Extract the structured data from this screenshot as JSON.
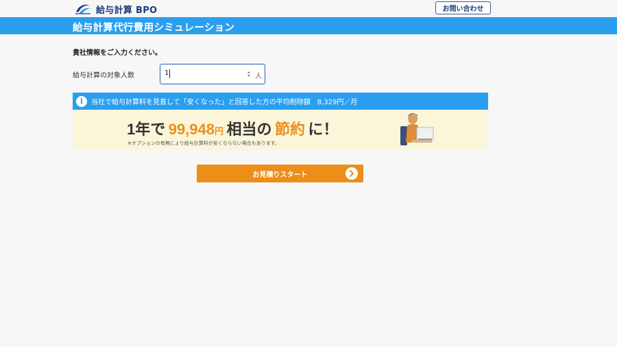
{
  "header": {
    "logo_text": "給与計算 BPO",
    "contact_label": "お問い合わせ"
  },
  "title_bar": {
    "title": "給与計算代行費用シミュレーション"
  },
  "form": {
    "prompt": "貴社情報をご入力ください。",
    "field_label": "給与計算の対象人数",
    "field_value": "1",
    "unit": "人"
  },
  "info": {
    "icon": "info-icon",
    "text": "当社で給与計算料を見直して「安くなった」と回答した方の平均削除額　8,329円／月"
  },
  "saving": {
    "prefix": "1年で",
    "amount": "99,948",
    "yen": "円",
    "middle": "相当の",
    "keyword": "節約",
    "suffix": "に！",
    "note": "※オプションの有無により給与計算料が安くならない場合もあります。"
  },
  "cta": {
    "label": "お見積りスタート",
    "icon": "chevron-right-icon"
  },
  "colors": {
    "brand_blue": "#2a9ff0",
    "navy": "#1d3d7a",
    "accent_orange": "#ec8e18",
    "highlight_bg": "#fbf6da"
  }
}
